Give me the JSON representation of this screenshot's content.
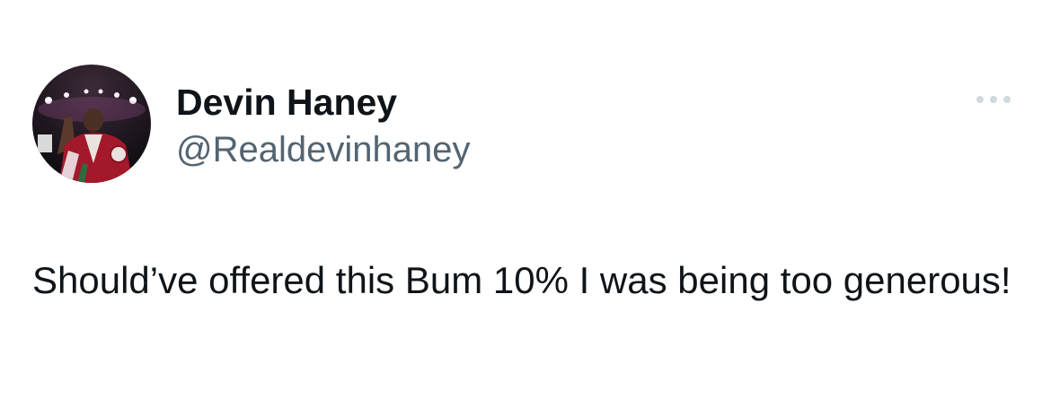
{
  "tweet": {
    "author": {
      "display_name": "Devin Haney",
      "handle": "@Realdevinhaney",
      "avatar_icon": "boxer-avatar-photo"
    },
    "more_icon": "more-options-icon",
    "text": "Should’ve offered this Bum 10% I was being too generous!"
  },
  "colors": {
    "text_primary": "#0f1419",
    "text_secondary": "#536471",
    "icon_muted": "#cfd9de",
    "background": "#ffffff"
  }
}
